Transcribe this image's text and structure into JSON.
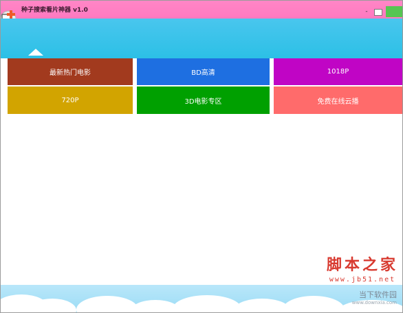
{
  "window": {
    "title": "种子搜索看片神器 v1.0",
    "controls": {
      "minimize": "-",
      "maximize": "",
      "close": ""
    }
  },
  "tiles": [
    {
      "label": "最新热门电影",
      "color": "#a23a1e"
    },
    {
      "label": "BD高清",
      "color": "#1e6fe1"
    },
    {
      "label": "1018P",
      "color": "#c005c5"
    },
    {
      "label": "720P",
      "color": "#d2a400"
    },
    {
      "label": "3D电影专区",
      "color": "#00a000"
    },
    {
      "label": "免费在线云播",
      "color": "#ff6b6b"
    }
  ],
  "watermark": {
    "main": "脚本之家",
    "url": "www.jb51.net",
    "corner": "当下软件园",
    "corner_url": "www.downxia.com"
  }
}
